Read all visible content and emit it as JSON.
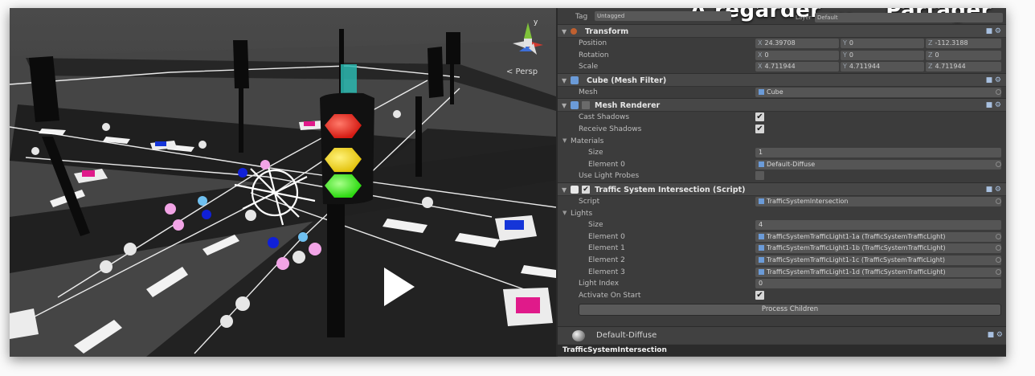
{
  "scene": {
    "view_mode_label": "< Persp",
    "gizmo_axis_y": "y",
    "play_icon": "play-icon"
  },
  "overlay": {
    "watch_later": "A regarder ...",
    "share": "Partager"
  },
  "header": {
    "tag_label": "Tag",
    "tag_value": "Untagged",
    "layer_label": "Layer",
    "layer_value": "Default"
  },
  "transform": {
    "title": "Transform",
    "rows": [
      {
        "label": "Position",
        "x": "24.39708",
        "y": "0",
        "z": "-112.3188"
      },
      {
        "label": "Rotation",
        "x": "0",
        "y": "0",
        "z": "0"
      },
      {
        "label": "Scale",
        "x": "4.711944",
        "y": "4.711944",
        "z": "4.711944"
      }
    ],
    "axes": [
      "X",
      "Y",
      "Z"
    ]
  },
  "mesh_filter": {
    "title": "Cube (Mesh Filter)",
    "mesh_label": "Mesh",
    "mesh_value": "Cube"
  },
  "mesh_renderer": {
    "title": "Mesh Renderer",
    "cast_shadows_label": "Cast Shadows",
    "receive_shadows_label": "Receive Shadows",
    "materials_label": "Materials",
    "size_label": "Size",
    "size_value": "1",
    "element0_label": "Element 0",
    "element0_value": "Default-Diffuse",
    "light_probes_label": "Use Light Probes"
  },
  "script": {
    "title": "Traffic System Intersection (Script)",
    "script_label": "Script",
    "script_value": "TrafficSystemIntersection",
    "lights_label": "Lights",
    "size_label": "Size",
    "size_value": "4",
    "elements": [
      {
        "label": "Element 0",
        "value": "TrafficSystemTrafficLight1-1a (TrafficSystemTrafficLight)"
      },
      {
        "label": "Element 1",
        "value": "TrafficSystemTrafficLight1-1b (TrafficSystemTrafficLight)"
      },
      {
        "label": "Element 2",
        "value": "TrafficSystemTrafficLight1-1c (TrafficSystemTrafficLight)"
      },
      {
        "label": "Element 3",
        "value": "TrafficSystemTrafficLight1-1d (TrafficSystemTrafficLight)"
      }
    ],
    "light_index_label": "Light Index",
    "light_index_value": "0",
    "activate_label": "Activate On Start",
    "process_button": "Process Children"
  },
  "material": {
    "name": "Default-Diffuse"
  },
  "footer": {
    "label": "TrafficSystemIntersection"
  },
  "checkmark": "✔",
  "colors": {
    "red_light": "#e8251b",
    "yellow_light": "#f2d51a",
    "green_light": "#39e21a",
    "panel_bg": "#3c3c3c"
  }
}
